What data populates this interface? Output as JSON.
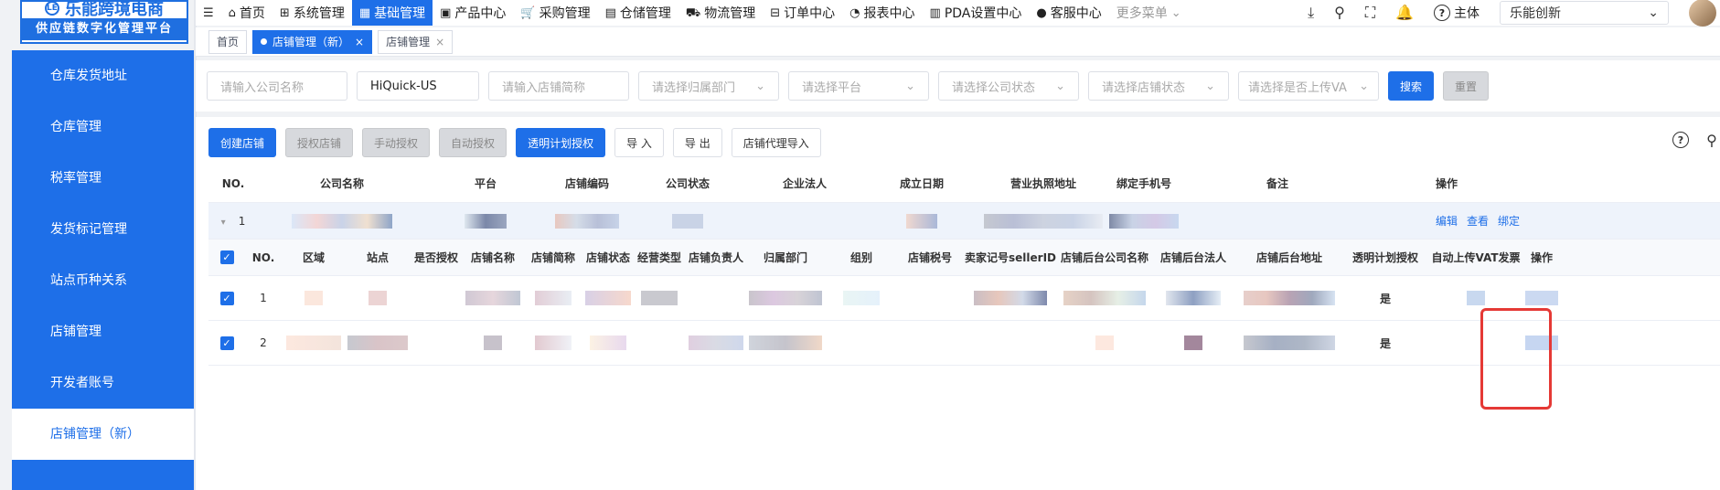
{
  "logo": {
    "title": "乐能跨境电商",
    "subtitle": "供应链数字化管理平台"
  },
  "sidebar": {
    "items": [
      {
        "label": "仓库发货地址"
      },
      {
        "label": "仓库管理"
      },
      {
        "label": "税率管理"
      },
      {
        "label": "发货标记管理"
      },
      {
        "label": "站点币种关系"
      },
      {
        "label": "店铺管理"
      },
      {
        "label": "开发者账号"
      },
      {
        "label": "店铺管理（新）"
      }
    ]
  },
  "topnav": {
    "items": [
      {
        "label": "首页",
        "icon": "home-icon"
      },
      {
        "label": "系统管理",
        "icon": "sitemap-icon"
      },
      {
        "label": "基础管理",
        "icon": "grid-icon"
      },
      {
        "label": "产品中心",
        "icon": "box-icon"
      },
      {
        "label": "采购管理",
        "icon": "cart-icon"
      },
      {
        "label": "仓储管理",
        "icon": "warehouse-icon"
      },
      {
        "label": "物流管理",
        "icon": "truck-icon"
      },
      {
        "label": "订单中心",
        "icon": "order-icon"
      },
      {
        "label": "报表中心",
        "icon": "chart-icon"
      },
      {
        "label": "PDA设置中心",
        "icon": "pda-icon"
      },
      {
        "label": "客服中心",
        "icon": "user-icon"
      }
    ],
    "more": "更多菜单",
    "theme": "主体",
    "company": "乐能创新"
  },
  "tabs": [
    {
      "label": "首页"
    },
    {
      "label": "店铺管理（新）"
    },
    {
      "label": "店铺管理"
    }
  ],
  "search": {
    "company_placeholder": "请输入公司名称",
    "keyword_value": "HiQuick-US",
    "shortname_placeholder": "请输入店铺简称",
    "dept_placeholder": "请选择归属部门",
    "platform_placeholder": "请选择平台",
    "company_status_placeholder": "请选择公司状态",
    "shop_status_placeholder": "请选择店铺状态",
    "vat_placeholder": "请选择是否上传VA",
    "search_label": "搜索",
    "reset_label": "重置"
  },
  "toolbar": {
    "create": "创建店铺",
    "auth_shop": "授权店铺",
    "manual_auth": "手动授权",
    "auto_auth": "自动授权",
    "transparent_auth": "透明计划授权",
    "import": "导 入",
    "export": "导 出",
    "agent_import": "店铺代理导入"
  },
  "table": {
    "headers": [
      "NO.",
      "公司名称",
      "平台",
      "店铺编码",
      "公司状态",
      "企业法人",
      "成立日期",
      "营业执照地址",
      "绑定手机号",
      "备注",
      "操作"
    ],
    "row1": {
      "no": "1",
      "ops": [
        "编辑",
        "查看",
        "绑定"
      ]
    }
  },
  "nested": {
    "headers": [
      "NO.",
      "区域",
      "站点",
      "是否授权",
      "店铺名称",
      "店铺简称",
      "店铺状态",
      "经营类型",
      "店铺负责人",
      "归属部门",
      "组别",
      "店铺税号",
      "卖家记号sellerID",
      "店铺后台公司名称",
      "店铺后台法人",
      "店铺后台地址",
      "透明计划授权",
      "自动上传VAT发票",
      "操作"
    ],
    "rows": [
      {
        "no": "1",
        "transparent": "是"
      },
      {
        "no": "2",
        "transparent": "是"
      }
    ]
  },
  "colors": {
    "primary": "#1e6fe8",
    "highlight": "#e53935"
  }
}
